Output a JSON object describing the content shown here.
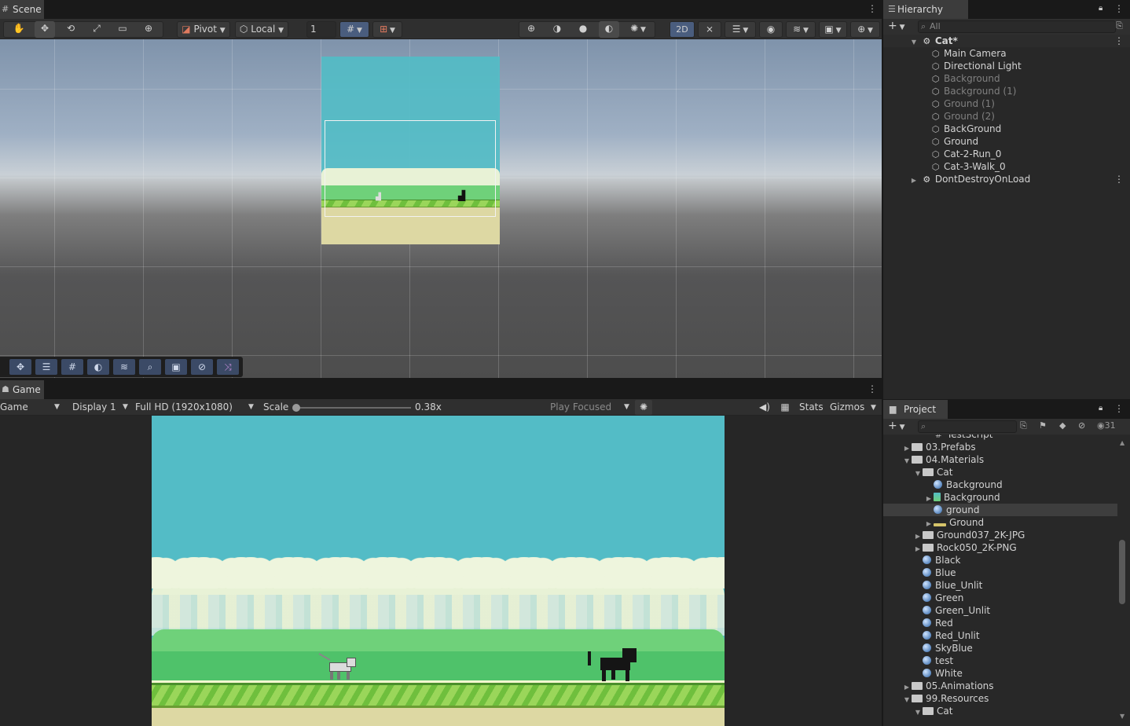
{
  "scene_tab": {
    "title": "Scene",
    "icon": "grid-icon"
  },
  "scene_toolbar": {
    "pivot_label": "Pivot",
    "local_label": "Local",
    "grid_value": "1",
    "mode_2d": "2D"
  },
  "game_tab": {
    "title": "Game"
  },
  "game_toolbar": {
    "mode": "Game",
    "display": "Display 1",
    "resolution": "Full HD (1920x1080)",
    "scale_label": "Scale",
    "scale_value": "0.38x",
    "play_mode": "Play Focused",
    "stats": "Stats",
    "gizmos": "Gizmos"
  },
  "hierarchy": {
    "title": "Hierarchy",
    "search_placeholder": "All",
    "scene_name": "Cat*",
    "items": [
      {
        "label": "Main Camera",
        "active": true
      },
      {
        "label": "Directional Light",
        "active": true
      },
      {
        "label": "Background",
        "active": false
      },
      {
        "label": "Background (1)",
        "active": false
      },
      {
        "label": "Ground (1)",
        "active": false
      },
      {
        "label": "Ground (2)",
        "active": false
      },
      {
        "label": "BackGround",
        "active": true
      },
      {
        "label": "Ground",
        "active": true
      },
      {
        "label": "Cat-2-Run_0",
        "active": true
      },
      {
        "label": "Cat-3-Walk_0",
        "active": true
      }
    ],
    "dont_destroy": "DontDestroyOnLoad"
  },
  "project": {
    "title": "Project",
    "visible_count": "31",
    "items": [
      {
        "label": "TestScript",
        "indent": 3,
        "type": "script"
      },
      {
        "label": "03.Prefabs",
        "indent": 1,
        "type": "folder",
        "expand": "collapsed"
      },
      {
        "label": "04.Materials",
        "indent": 1,
        "type": "folder",
        "expand": "expanded"
      },
      {
        "label": "Cat",
        "indent": 2,
        "type": "folder",
        "expand": "expanded"
      },
      {
        "label": "Background",
        "indent": 3,
        "type": "material"
      },
      {
        "label": "Background",
        "indent": 3,
        "type": "texture",
        "expand": "collapsed"
      },
      {
        "label": "ground",
        "indent": 3,
        "type": "material",
        "selected": true
      },
      {
        "label": "Ground",
        "indent": 3,
        "type": "ground-texture",
        "expand": "collapsed"
      },
      {
        "label": "Ground037_2K-JPG",
        "indent": 2,
        "type": "folder",
        "expand": "collapsed"
      },
      {
        "label": "Rock050_2K-PNG",
        "indent": 2,
        "type": "folder",
        "expand": "collapsed"
      },
      {
        "label": "Black",
        "indent": 2,
        "type": "material"
      },
      {
        "label": "Blue",
        "indent": 2,
        "type": "material"
      },
      {
        "label": "Blue_Unlit",
        "indent": 2,
        "type": "material"
      },
      {
        "label": "Green",
        "indent": 2,
        "type": "material"
      },
      {
        "label": "Green_Unlit",
        "indent": 2,
        "type": "material"
      },
      {
        "label": "Red",
        "indent": 2,
        "type": "material"
      },
      {
        "label": "Red_Unlit",
        "indent": 2,
        "type": "material"
      },
      {
        "label": "SkyBlue",
        "indent": 2,
        "type": "material"
      },
      {
        "label": "test",
        "indent": 2,
        "type": "material"
      },
      {
        "label": "White",
        "indent": 2,
        "type": "material"
      },
      {
        "label": "05.Animations",
        "indent": 1,
        "type": "folder",
        "expand": "collapsed"
      },
      {
        "label": "99.Resources",
        "indent": 1,
        "type": "folder",
        "expand": "expanded"
      },
      {
        "label": "Cat",
        "indent": 2,
        "type": "folder",
        "expand": "expanded"
      }
    ]
  },
  "colors": {
    "sky": "#53bcc6",
    "panel": "#282828",
    "selection": "#3e3e3e",
    "accent": "#4a5d7e"
  }
}
